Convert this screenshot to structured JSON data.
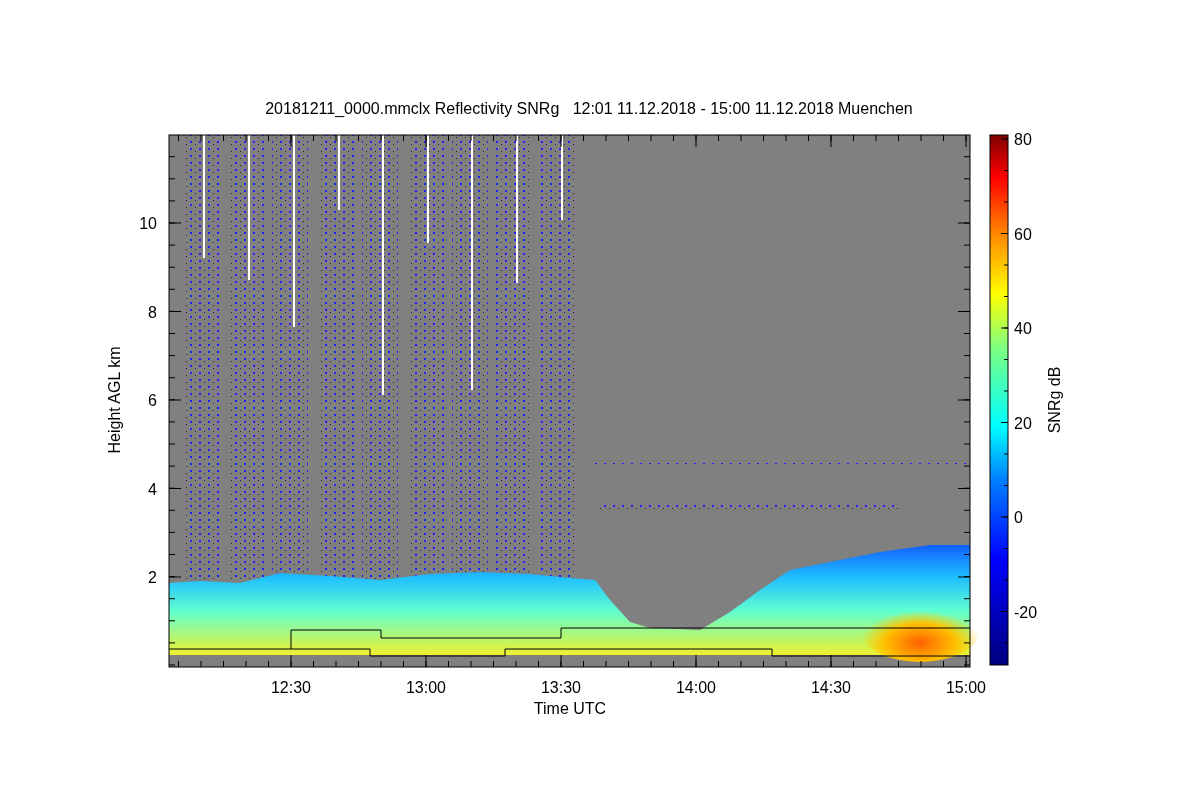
{
  "title": "20181211_0000.mmclx Reflectivity SNRg   12:01 11.12.2018 - 15:00 11.12.2018 Muenchen",
  "plot": {
    "ylabel": "Height AGL km",
    "xlabel": "Time UTC",
    "yticks": [
      "10",
      "8",
      "6",
      "4",
      "2"
    ],
    "xticks": [
      "12:30",
      "13:00",
      "13:30",
      "14:00",
      "14:30",
      "15:00"
    ]
  },
  "colorbar": {
    "label": "SNRg dB",
    "ticks": [
      "80",
      "60",
      "40",
      "20",
      "0",
      "-20"
    ]
  }
}
